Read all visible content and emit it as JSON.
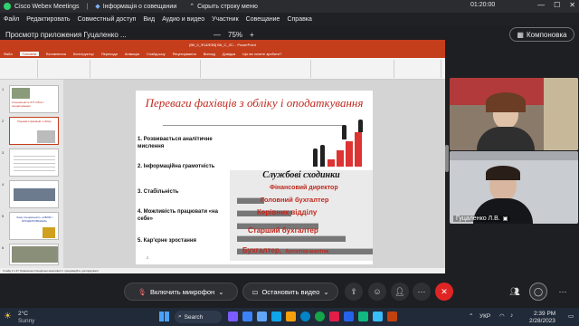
{
  "titlebar": {
    "app": "Cisco Webex Meetings",
    "info": "Інформація о совещании",
    "hide": "Скрыть строку меню",
    "timer": "01:20:00"
  },
  "menu": [
    "Файл",
    "Редактировать",
    "Совместный доступ",
    "Вид",
    "Аудио и видео",
    "Участник",
    "Совещание",
    "Справка"
  ],
  "share": {
    "title": "Просмотр приложения Гуцаленко ...",
    "zoom_out": "—",
    "zoom": "75%",
    "zoom_in": "+",
    "layout_button": "Компоновка"
  },
  "ppt": {
    "filename": "[ВК_0_Ф1&ФЗВ] ВК_С_ЗС... PowerPoint",
    "tabs": [
      "Файл",
      "Головна",
      "Вставлення",
      "Конструктор",
      "Переходи",
      "Анімація",
      "Слайд-шоу",
      "Рецензування",
      "Вигляд",
      "Довідка",
      "Що ви хочете зробити?"
    ],
    "status": "Слайд 2 з 37   Українська   Спеціальні можливості: продовжуйте досліджувати",
    "thumbnails": [
      {
        "num": "1",
        "text": "Спеціальність 071 Облік і оподаткування"
      },
      {
        "num": "2",
        "text": "Переваги фахівців з обліку"
      },
      {
        "num": "3",
        "text": ""
      },
      {
        "num": "4",
        "text": ""
      },
      {
        "num": "5",
        "text": "Чому спеціальність «ОБЛІК І ОПОДАТКУВАННЯ»"
      },
      {
        "num": "6",
        "text": ""
      }
    ]
  },
  "slide": {
    "title": "Переваги фахівців з обліку і оподаткування",
    "bullets": [
      "1.  Розвивається аналітичне мислення",
      "2.   Інформаційна грамотність",
      "3.  Стабільність",
      "4.  Можливість працювати «на себе»",
      "5. Кар'єрне зростання"
    ],
    "page": "2",
    "career": {
      "heading": "Службові сходинки",
      "steps": [
        "Фінансовий директор",
        "Головний бухгалтер",
        "Керівник відділу",
        "Старший бухгалтер",
        "Бухгалтер,"
      ],
      "last_suffix": "бухгалтер-аналітик"
    }
  },
  "participants": [
    {
      "name": ""
    },
    {
      "name": "Гуцаленко Л.В."
    }
  ],
  "controls": {
    "mic": "Включить микрофон",
    "video": "Остановить видео"
  },
  "taskbar": {
    "temp": "2°C",
    "weather": "Sunny",
    "search": "Search",
    "lang": "УКР",
    "time": "2:39 PM",
    "date": "2/28/2023"
  }
}
